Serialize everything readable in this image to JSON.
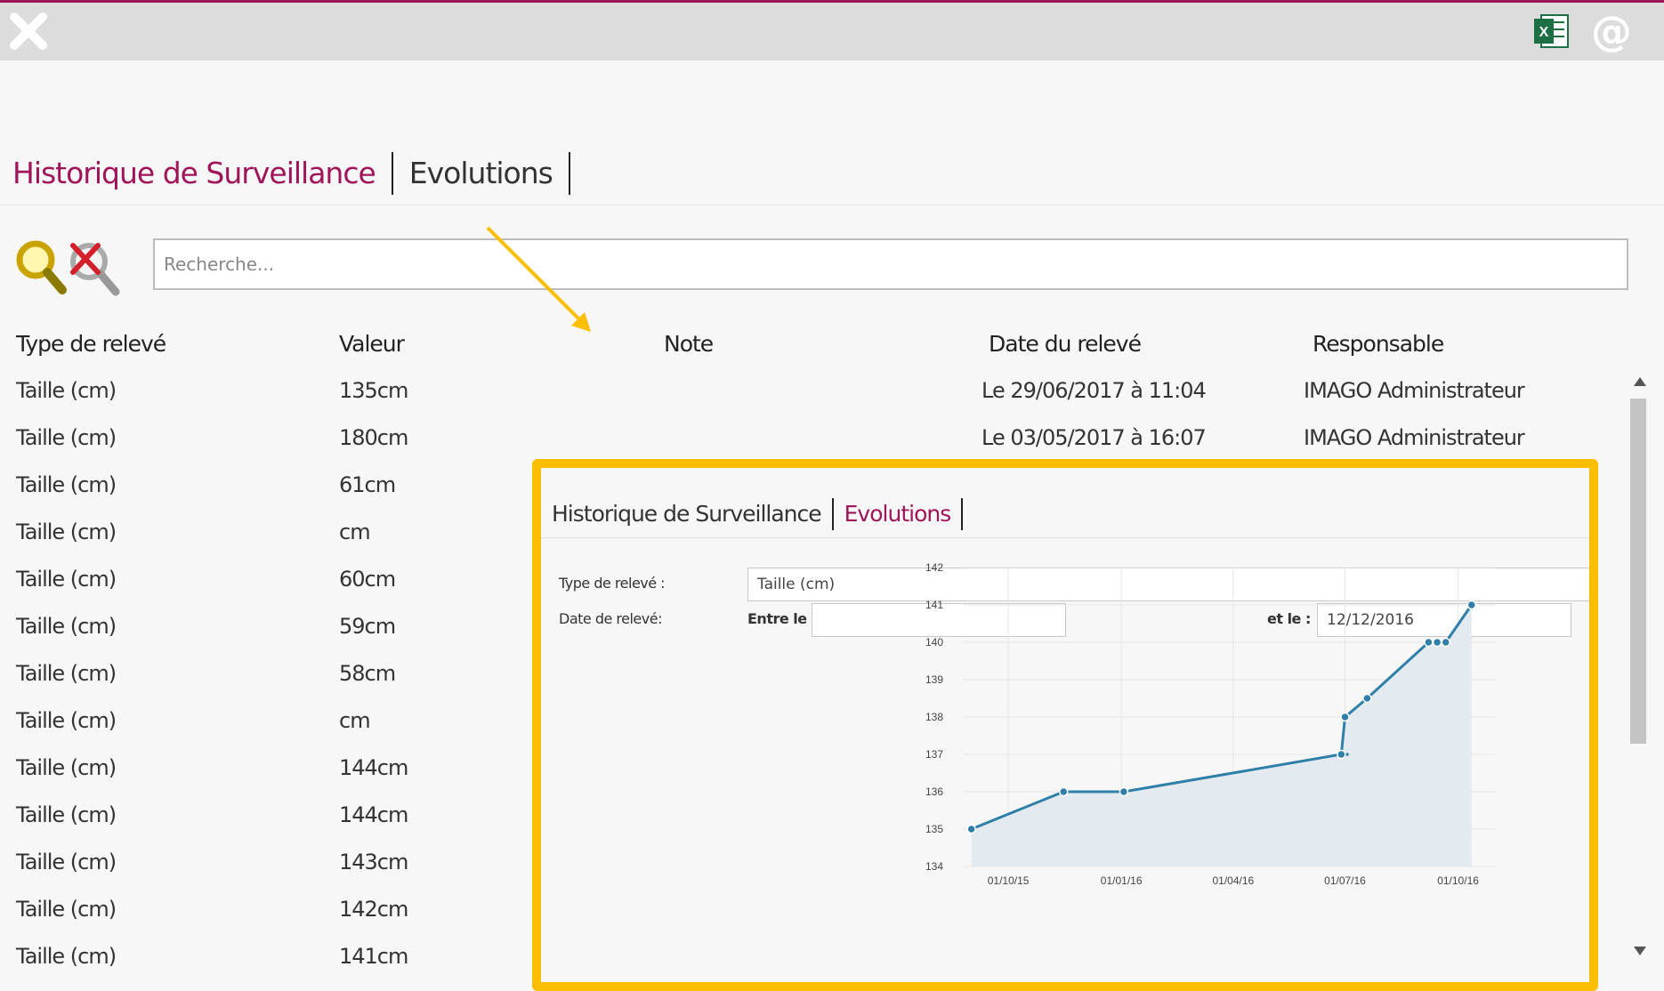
{
  "toolbar": {
    "close_icon": "close-icon",
    "excel_icon": "excel-export-icon",
    "email_icon": "at-sign-icon",
    "email_glyph": "@",
    "excel_glyph": "X",
    "accent": "#a0155a"
  },
  "tabs": [
    {
      "label": "Historique de Surveillance",
      "active": true
    },
    {
      "label": "Evolutions",
      "active": false
    }
  ],
  "search": {
    "placeholder": "Recherche...",
    "value": ""
  },
  "table": {
    "columns": [
      "Type de relevé",
      "Valeur",
      "Note",
      "Date du relevé",
      "Responsable"
    ],
    "rows": [
      {
        "type": "Taille (cm)",
        "value": "135cm",
        "note": "",
        "date": "Le 29/06/2017 à 11:04",
        "responsable": "IMAGO Administrateur"
      },
      {
        "type": "Taille (cm)",
        "value": "180cm",
        "note": "",
        "date": "Le 03/05/2017 à 16:07",
        "responsable": "IMAGO Administrateur"
      },
      {
        "type": "Taille (cm)",
        "value": "61cm",
        "note": "",
        "date": "",
        "responsable": ""
      },
      {
        "type": "Taille (cm)",
        "value": "cm",
        "note": "",
        "date": "",
        "responsable": ""
      },
      {
        "type": "Taille (cm)",
        "value": "60cm",
        "note": "",
        "date": "",
        "responsable": ""
      },
      {
        "type": "Taille (cm)",
        "value": "59cm",
        "note": "",
        "date": "",
        "responsable": ""
      },
      {
        "type": "Taille (cm)",
        "value": "58cm",
        "note": "",
        "date": "",
        "responsable": ""
      },
      {
        "type": "Taille (cm)",
        "value": "cm",
        "note": "",
        "date": "",
        "responsable": ""
      },
      {
        "type": "Taille (cm)",
        "value": "144cm",
        "note": "",
        "date": "",
        "responsable": ""
      },
      {
        "type": "Taille (cm)",
        "value": "144cm",
        "note": "",
        "date": "",
        "responsable": ""
      },
      {
        "type": "Taille (cm)",
        "value": "143cm",
        "note": "",
        "date": "",
        "responsable": ""
      },
      {
        "type": "Taille (cm)",
        "value": "142cm",
        "note": "",
        "date": "",
        "responsable": ""
      },
      {
        "type": "Taille (cm)",
        "value": "141cm",
        "note": "",
        "date": "",
        "responsable": ""
      }
    ]
  },
  "inset": {
    "border_color": "#fbbe00",
    "tabs": [
      {
        "label": "Historique de Surveillance",
        "active": false
      },
      {
        "label": "Evolutions",
        "active": true
      }
    ],
    "form": {
      "type_label": "Type de relevé :",
      "type_value": "Taille (cm)",
      "date_label": "Date de relevé:",
      "from_label": "Entre le :",
      "from_value": "",
      "to_label": "et le :",
      "to_value": "12/12/2016"
    }
  },
  "chart_data": {
    "type": "area",
    "series": [
      {
        "color": "#2f7fa8",
        "points": [
          {
            "x": "2015-09-01",
            "y": 135
          },
          {
            "x": "2015-11-15",
            "y": 136
          },
          {
            "x": "2016-01-03",
            "y": 136
          },
          {
            "x": "2016-06-28",
            "y": 137
          },
          {
            "x": "2016-07-01",
            "y": 138
          },
          {
            "x": "2016-07-19",
            "y": 138.5
          },
          {
            "x": "2016-09-07",
            "y": 140
          },
          {
            "x": "2016-09-14",
            "y": 140
          },
          {
            "x": "2016-09-21",
            "y": 140
          },
          {
            "x": "2016-10-12",
            "y": 141
          }
        ]
      }
    ],
    "extra_points": [
      {
        "x": "2016-07-04",
        "y": 137
      }
    ],
    "x_ticks": [
      "01/10/15",
      "01/01/16",
      "01/04/16",
      "01/07/16",
      "01/10/16"
    ],
    "x_tick_dates": [
      "2015-10-01",
      "2016-01-01",
      "2016-04-01",
      "2016-07-01",
      "2016-10-01"
    ],
    "y_ticks": [
      134,
      135,
      136,
      137,
      138,
      139,
      140,
      141,
      142
    ],
    "ylim": [
      134,
      142
    ],
    "xlim": [
      "2015-08-25",
      "2016-10-31"
    ],
    "grid": true,
    "fill_color": "#e3ebf1"
  }
}
